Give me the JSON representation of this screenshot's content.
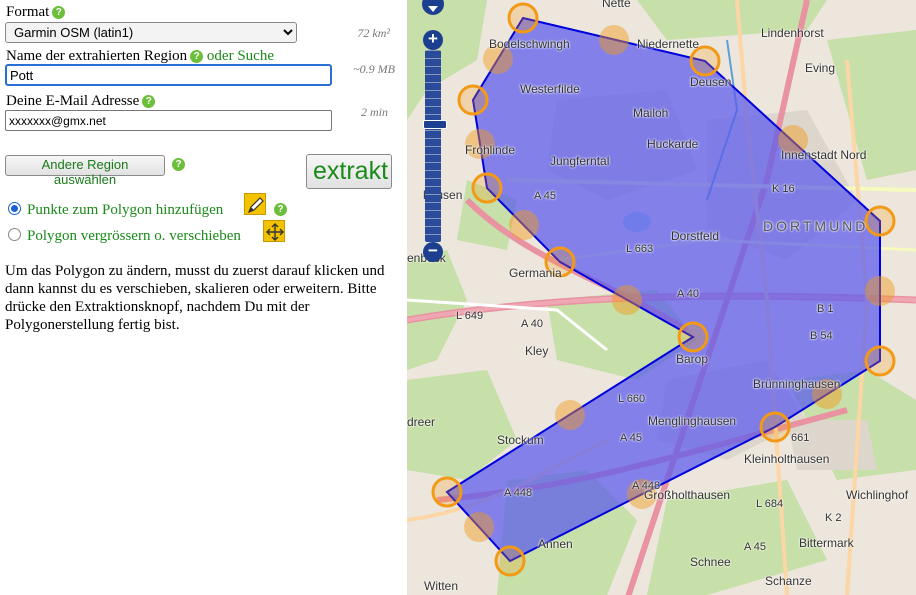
{
  "form": {
    "format_label": "Format",
    "format_value": "Garmin OSM (latin1)",
    "area_hint": "72 km²",
    "region_label": "Name der extrahierten Region",
    "region_search_link": "oder Suche",
    "region_value": "Pott",
    "size_hint": "~0.9 MB",
    "email_label": "Deine E-Mail Adresse",
    "email_value": "xxxxxxx@gmx.net",
    "time_hint": "2 min",
    "other_region_button": "Andere Region auswählen",
    "extract_button": "extrakt",
    "radio_add_points": "Punkte zum Polygon hinzufügen",
    "radio_resize_move": "Polygon vergrössern o. verschieben",
    "instructions": "Um das Polygon zu ändern, musst du zuerst darauf klicken und dann kannst du es verschieben, skalieren oder erweitern. Bitte drücke den Extraktionsknopf, nachdem Du mit der Polygonerstellung fertig bist."
  },
  "map": {
    "places": {
      "nette": "Nette",
      "bodelschwingh": "Bodelschwingh",
      "niedernette": "Niedernette",
      "lindenhorst": "Lindenhorst",
      "deusen": "Deusen",
      "evring": "Eving",
      "westerfilde": "Westerfilde",
      "mailoh": "Mailoh",
      "huckarde": "Huckarde",
      "innenstadt_nord": "Innenstadt Nord",
      "froehlinde": "Frohlinde",
      "jungferntal": "Jungferntal",
      "dortmund": "DORTMUND",
      "dorstfeld": "Dorstfeld",
      "germania": "Germania",
      "kley": "Kley",
      "barop": "Barop",
      "bruenninghausen": "Brünninghausen",
      "stockum": "Stockum",
      "menglinghausen": "Menglinghausen",
      "kleinholthausen": "Kleinholthausen",
      "grossholthausen": "Großholthausen",
      "wichlinghofen": "Wichlinghof",
      "annen": "Annen",
      "bittermark": "Bittermark",
      "schnee": "Schnee",
      "schanze": "Schanze",
      "witten": "Witten",
      "hausen": "hausen",
      "dreer": "dreer",
      "enbeck": "enbeck"
    },
    "roads": {
      "a45_north": "A 45",
      "k16": "K 16",
      "l663": "L 663",
      "l649": "L 649",
      "a40_west": "A 40",
      "a40_east": "A 40",
      "b1": "B 1",
      "b54": "B 54",
      "l660": "L 660",
      "a45_south": "A 45",
      "a448_west": "A 448",
      "a448_east": "A 448",
      "l661": "661",
      "l684": "L 684",
      "k2": "K 2",
      "a45_se": "A 45"
    },
    "colors": {
      "polygon_fill": "#5a5aee",
      "polygon_stroke": "#0000dd",
      "vertex": "#f29a16"
    }
  }
}
